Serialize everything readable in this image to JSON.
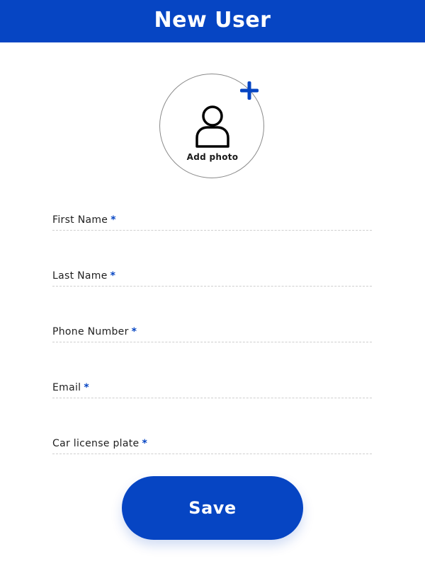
{
  "header": {
    "title": "New User"
  },
  "avatar": {
    "add_photo_label": "Add photo",
    "icon": "person-icon",
    "add_icon": "plus-icon"
  },
  "form": {
    "required_marker": "*",
    "fields": [
      {
        "label": "First Name",
        "value": ""
      },
      {
        "label": "Last Name",
        "value": ""
      },
      {
        "label": "Phone Number",
        "value": ""
      },
      {
        "label": "Email",
        "value": ""
      },
      {
        "label": "Car license plate",
        "value": ""
      }
    ]
  },
  "actions": {
    "save_label": "Save"
  },
  "colors": {
    "primary": "#0645C3",
    "background": "#FFFFFF",
    "text": "#1F1F1F",
    "divider": "#CFCFCF"
  }
}
